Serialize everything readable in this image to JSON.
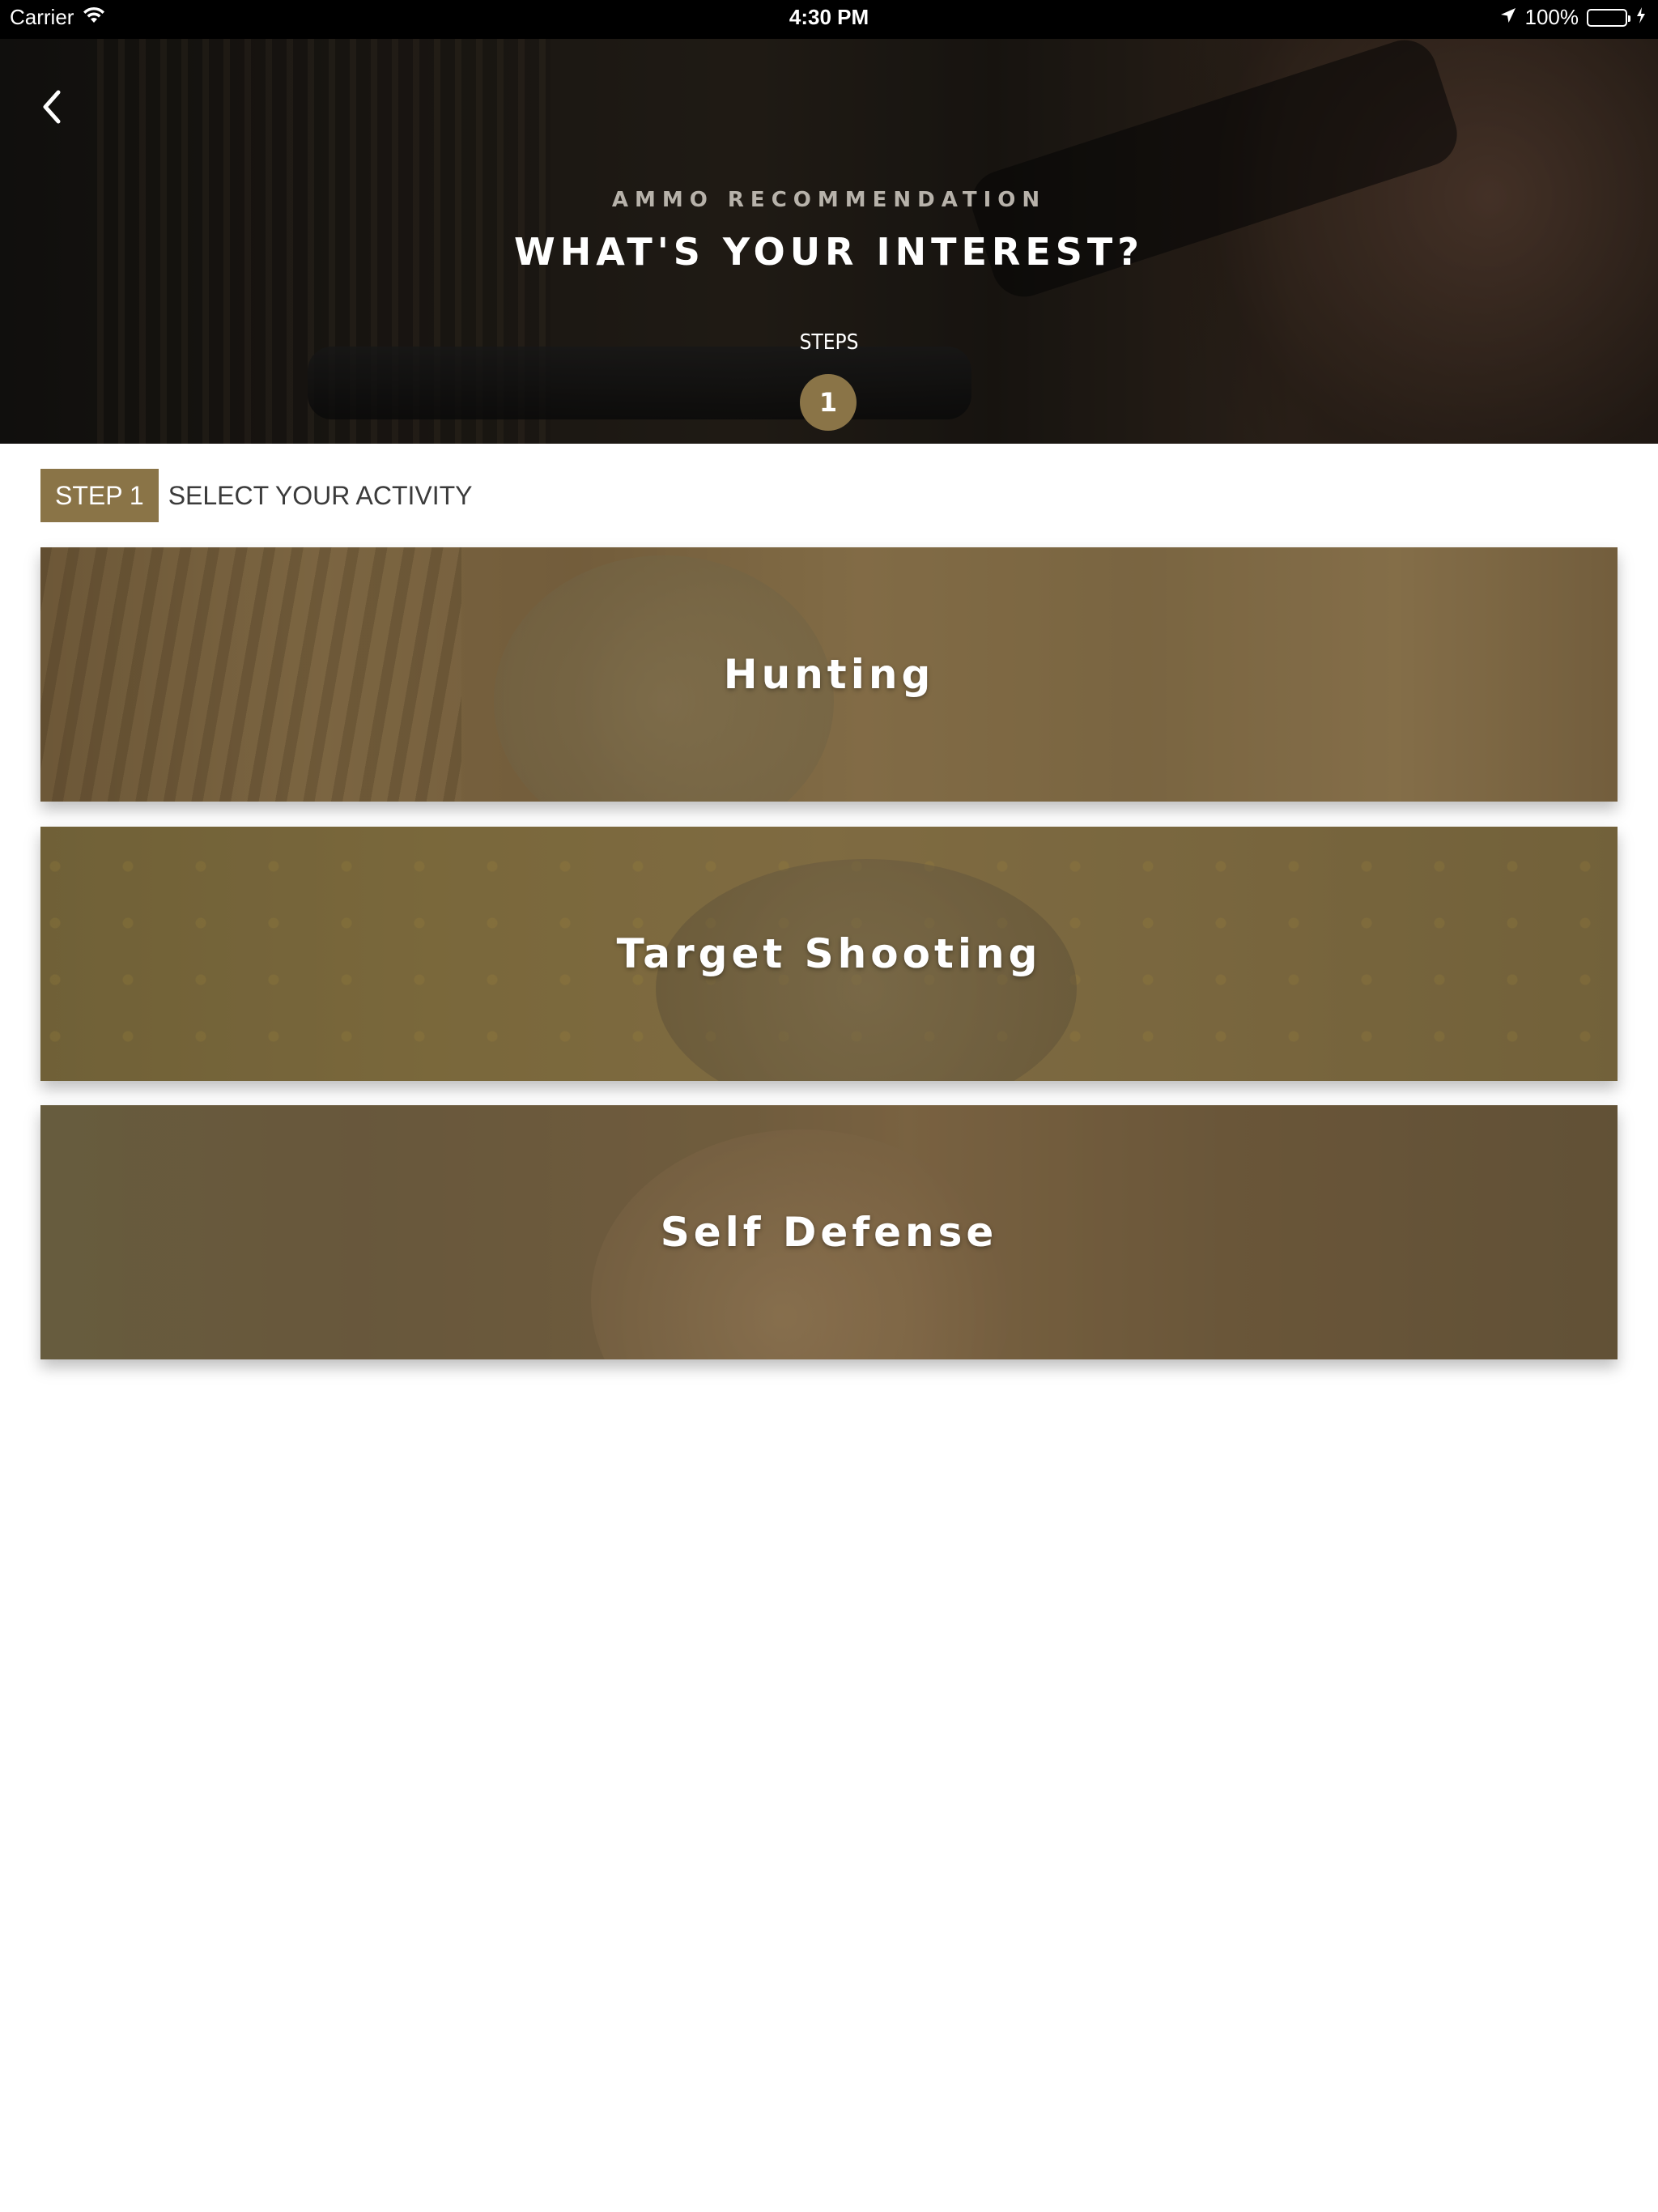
{
  "status_bar": {
    "carrier": "Carrier",
    "time": "4:30 PM",
    "battery": "100%"
  },
  "header": {
    "eyebrow": "AMMO RECOMMENDATION",
    "title": "WHAT'S YOUR INTEREST?",
    "steps_label": "STEPS",
    "current_step": "1"
  },
  "step": {
    "badge": "STEP 1",
    "instruction": "SELECT YOUR ACTIVITY"
  },
  "activities": [
    {
      "label": "Hunting"
    },
    {
      "label": "Target Shooting"
    },
    {
      "label": "Self Defense"
    }
  ],
  "colors": {
    "accent": "#8a7447",
    "status_bar": "#000000",
    "battery": "#4cd964"
  },
  "icons": {
    "back": "chevron-left-icon",
    "wifi": "wifi-icon",
    "location": "location-arrow-icon",
    "battery": "battery-icon",
    "charging": "charging-bolt-icon"
  }
}
